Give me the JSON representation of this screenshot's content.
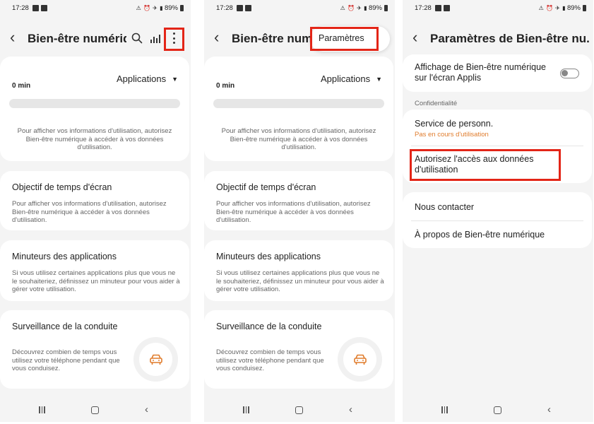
{
  "status_bar": {
    "time": "17:28",
    "right_glyphs": "⚠ ⏰ ✈ ▮",
    "battery": "89%"
  },
  "screen1": {
    "title": "Bien-être numériq...",
    "apps_selector": "Applications",
    "minutes": "0 min",
    "usage_progress": 0,
    "usage_permission_text": "Pour afficher vos informations d'utilisation, autorisez Bien-être numérique à accéder à vos données d'utilisation.",
    "goal_title": "Objectif de temps d'écran",
    "goal_desc": "Pour afficher vos informations d'utilisation, autorisez Bien-être numérique à accéder à vos données d'utilisation.",
    "timers_title": "Minuteurs des applications",
    "timers_desc": "Si vous utilisez certaines applications plus que vous ne le souhaiteriez, définissez un minuteur pour vous aider à gérer votre utilisation.",
    "driving_title": "Surveillance de la conduite",
    "driving_desc": "Découvrez combien de temps vous utilisez votre téléphone pendant que vous conduisez."
  },
  "screen2": {
    "title": "Bien-être numé",
    "menu_item": "Paramètres"
  },
  "screen3": {
    "title": "Paramètres de Bien-être nu...",
    "show_on_apps_label": "Affichage de Bien-être numérique sur l'écran Applis",
    "show_on_apps_enabled": false,
    "privacy_section": "Confidentialité",
    "personalization_label": "Service de personn.",
    "personalization_status": "Pas en cours d'utilisation",
    "allow_usage_access": "Autorisez l'accès aux données d'utilisation",
    "contact_us": "Nous contacter",
    "about": "À propos de Bien-être numérique"
  },
  "colors": {
    "highlight": "#e32517",
    "warning_text": "#e07c2c",
    "background": "#f4f4f4",
    "card": "#ffffff"
  }
}
